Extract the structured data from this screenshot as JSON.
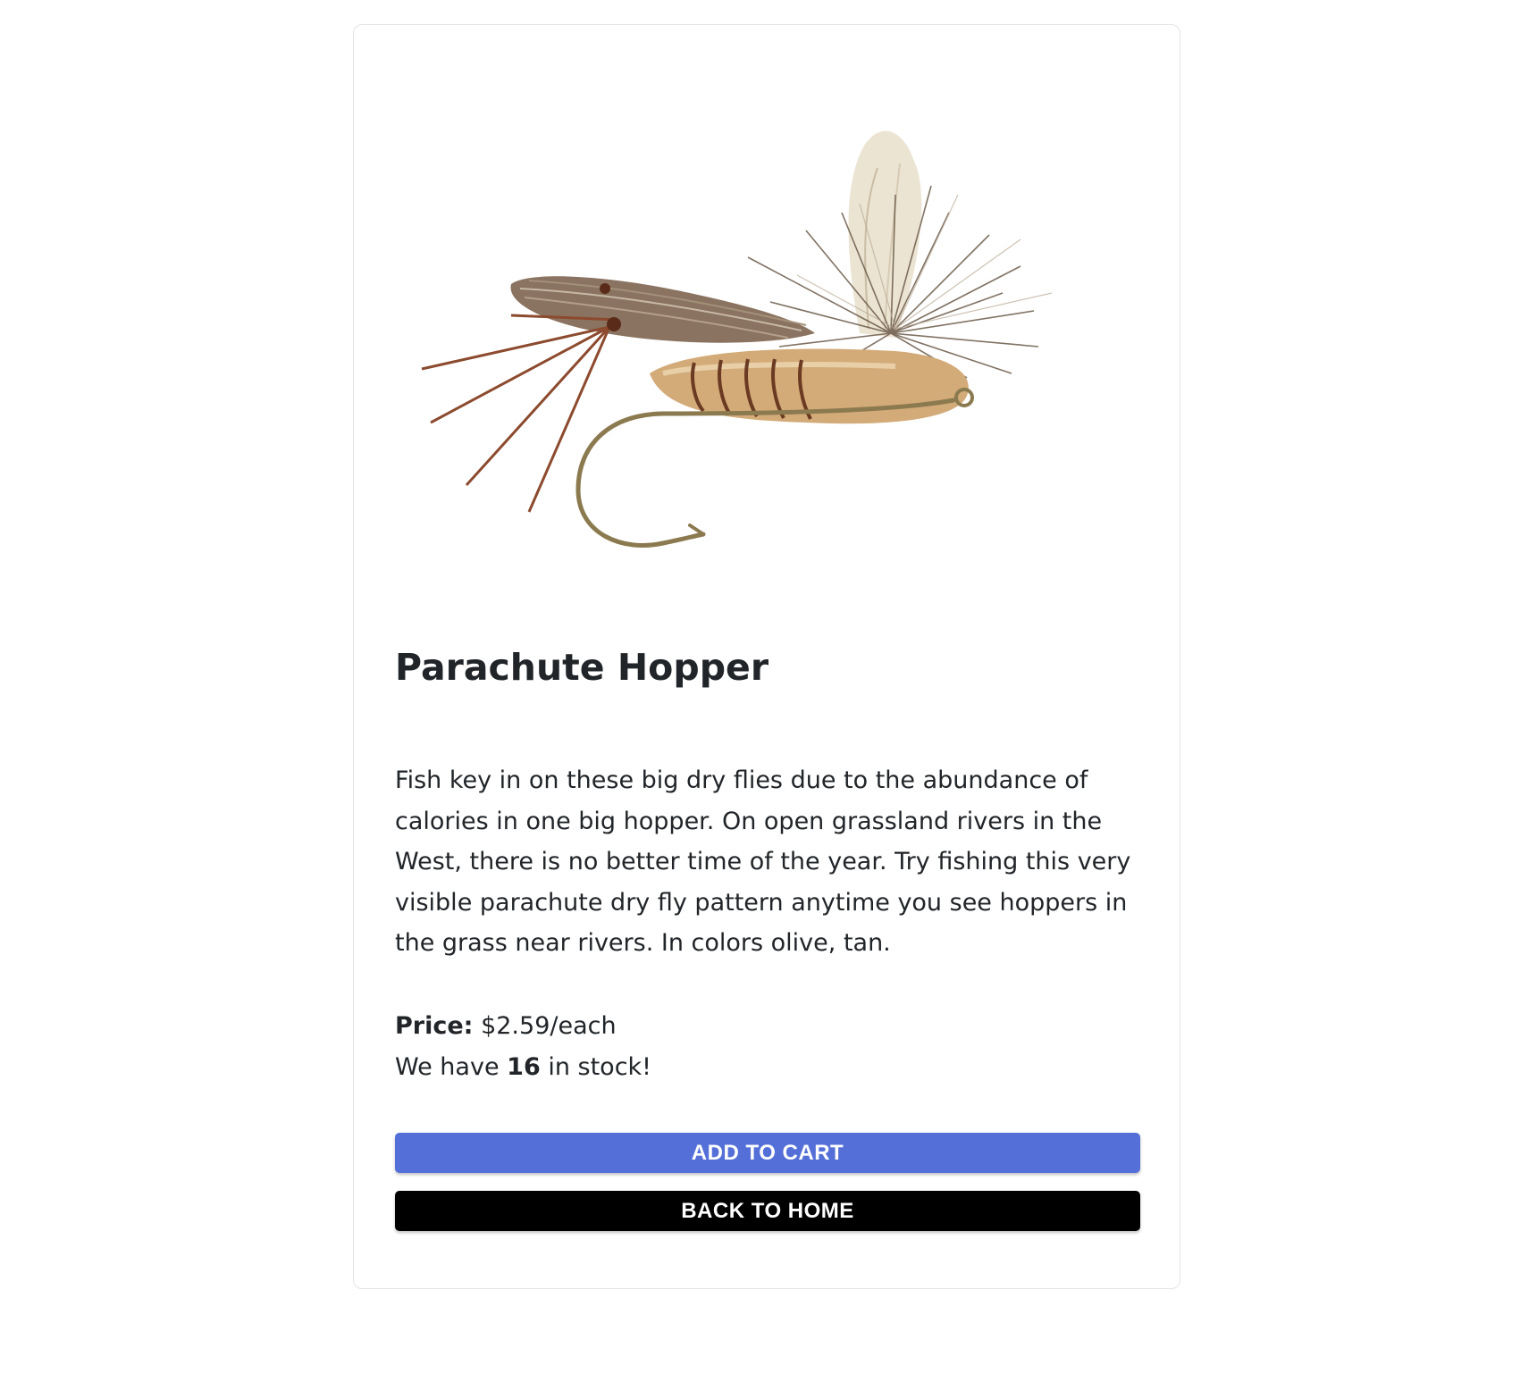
{
  "product": {
    "image_alt": "Parachute Hopper fly",
    "title": "Parachute Hopper",
    "description": "Fish key in on these big dry flies due to the abundance of calories in one big hopper. On open grassland rivers in the West, there is no better time of the year. Try fishing this very visible parachute dry fly pattern anytime you see hoppers in the grass near rivers. In colors olive, tan.",
    "price_label": "Price:",
    "price_value": "$2.59/each",
    "stock_prefix": "We have",
    "stock_count": "16",
    "stock_suffix": "in stock!"
  },
  "actions": {
    "add_to_cart": "ADD TO CART",
    "back_to_home": "BACK TO HOME"
  },
  "colors": {
    "add_to_cart_bg": "#5470d8",
    "back_to_home_bg": "#000000",
    "card_border": "#e4e4e4"
  }
}
